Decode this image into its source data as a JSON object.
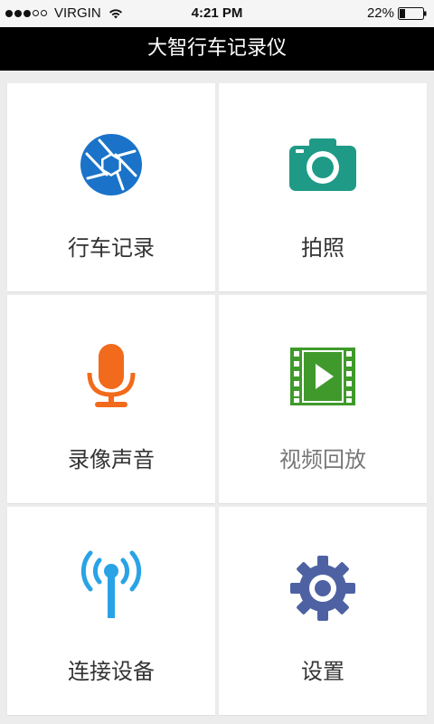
{
  "status_bar": {
    "carrier": "VIRGIN",
    "time": "4:21 PM",
    "battery": "22%",
    "signal_bars_filled": 3,
    "signal_bars_total": 5
  },
  "header": {
    "title": "大智行车记录仪"
  },
  "grid": {
    "items": [
      {
        "label": "行车记录",
        "icon": "aperture-icon",
        "color": "#1a73c9"
      },
      {
        "label": "拍照",
        "icon": "camera-icon",
        "color": "#1f9a86"
      },
      {
        "label": "录像声音",
        "icon": "microphone-icon",
        "color": "#f26a1b"
      },
      {
        "label": "视频回放",
        "icon": "video-play-icon",
        "color": "#3f9a2b"
      },
      {
        "label": "连接设备",
        "icon": "antenna-icon",
        "color": "#2aa3e6"
      },
      {
        "label": "设置",
        "icon": "gear-icon",
        "color": "#4e62a3"
      }
    ]
  }
}
